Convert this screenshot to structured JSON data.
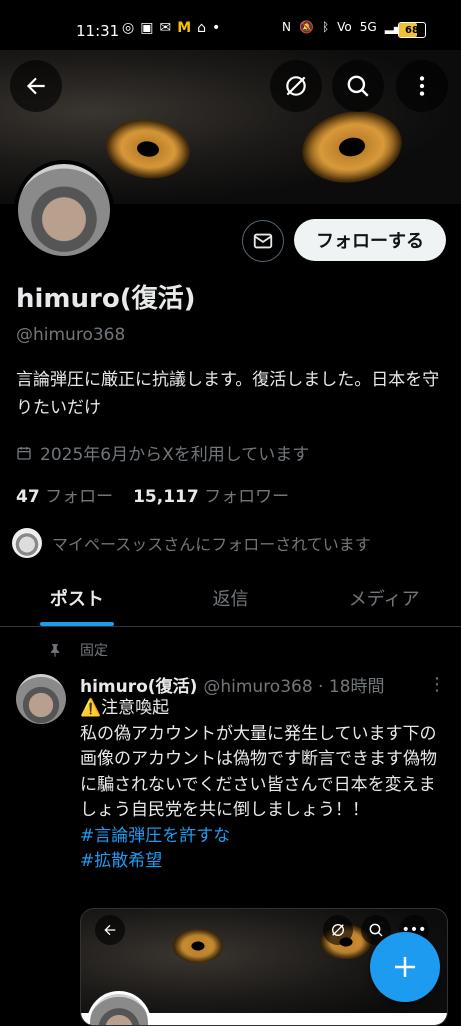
{
  "status_bar": {
    "time": "11:31",
    "battery": "68",
    "battery_level": 0.68,
    "left_icons": [
      "hotspot-icon",
      "line-icon",
      "mail-icon",
      "mcdonalds-icon",
      "app-icon",
      "dot-icon"
    ],
    "right_icons": [
      "nfc-icon",
      "mute-icon",
      "bluetooth-icon",
      "volte-icon",
      "5g-icon",
      "signal-icon"
    ]
  },
  "profile": {
    "display_name": "himuro(復活)",
    "handle": "@himuro368",
    "bio": "言論弾圧に厳正に抗議します。復活しました。日本を守りたいだけ",
    "joined": "2025年6月からXを利用しています",
    "following_count": "47",
    "following_label": "フォロー",
    "followers_count": "15,117",
    "followers_label": "フォロワー",
    "followed_by": "マイペースッスさんにフォローされています",
    "follow_button": "フォローする"
  },
  "tabs": [
    {
      "label": "ポスト",
      "active": true
    },
    {
      "label": "返信",
      "active": false
    },
    {
      "label": "メディア",
      "active": false
    }
  ],
  "pinned_post": {
    "pinned_label": "固定",
    "author_name": "himuro(復活)",
    "meta": "@himuro368 · 18時間",
    "text_lines": [
      "⚠️注意喚起",
      "私の偽アカウントが大量に発生しています下の画像のアカウントは偽物です断言できます偽物に騙されないでください皆さんで日本を変えましょう自民党を共に倒しましょう！！"
    ],
    "hashtags": [
      "#言論弾圧を許すな",
      "#拡散希望"
    ]
  },
  "colors": {
    "accent": "#1d9bf0",
    "muted": "#71767b",
    "text": "#e7e9ea",
    "background": "#000000"
  }
}
